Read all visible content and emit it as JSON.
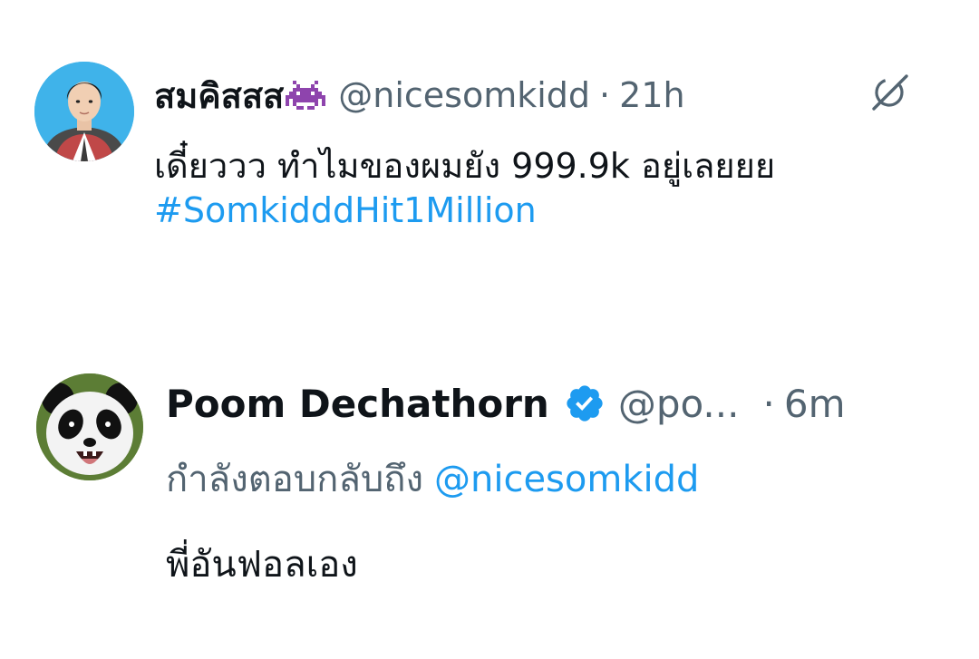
{
  "tweets": [
    {
      "display_name": "สมคิสสส",
      "name_emoji": "space-invader-icon",
      "handle": "@nicesomkidd",
      "separator": "·",
      "time": "21h",
      "text": "เดี๋ยววว ทำไมของผมยัง 999.9k อยู่เลยยย",
      "hashtag": "#SomkidddHit1Million",
      "corner_icon": "grok-icon"
    },
    {
      "display_name": "Poom Dechathorn",
      "verified": true,
      "handle": "@po...",
      "separator": "·",
      "time": "6m",
      "replying_to_label": "กำลังตอบกลับถึง",
      "replying_to_handle": "@nicesomkidd",
      "text": "พี่อันฟอลเอง"
    }
  ],
  "colors": {
    "text": "#0f1419",
    "secondary": "#536471",
    "link": "#1d9bf0",
    "verified": "#1d9bf0",
    "invader": "#8e44ad"
  }
}
